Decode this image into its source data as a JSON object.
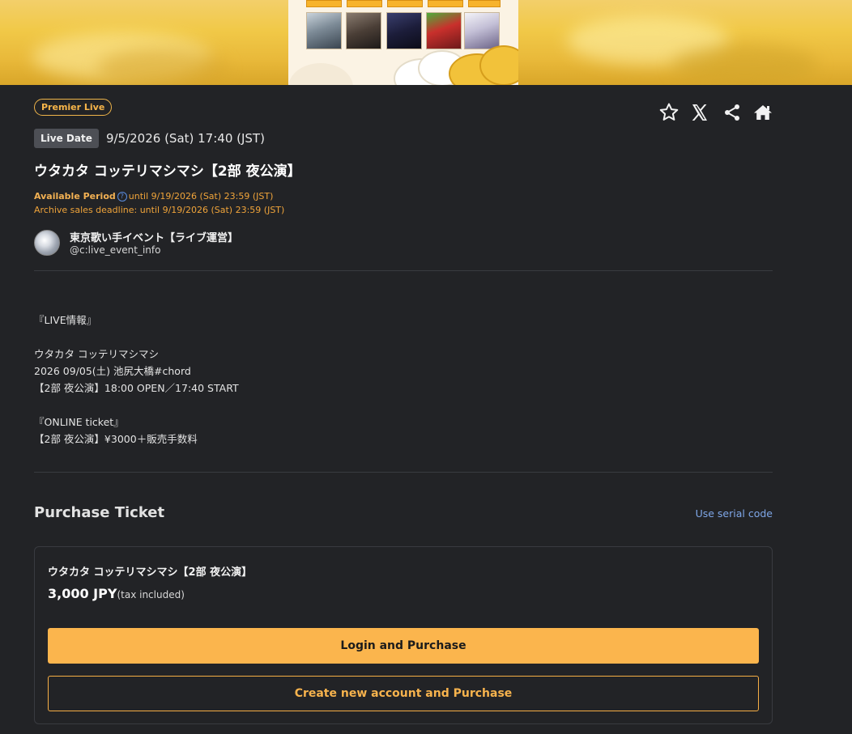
{
  "banner": {
    "accent": "#f1c948"
  },
  "event": {
    "badge": "Premier Live",
    "live_date_label": "Live Date",
    "live_date": "9/5/2026 (Sat) 17:40 (JST)",
    "title": "ウタカタ コッテリマシマシ【2部 夜公演】",
    "available_label": "Available Period",
    "available_value": "until 9/19/2026 (Sat) 23:59 (JST)",
    "archive_deadline": "Archive sales deadline: until 9/19/2026 (Sat) 23:59 (JST)"
  },
  "actions": {
    "icons": [
      "star-icon",
      "x-logo-icon",
      "share-icon",
      "home-icon"
    ]
  },
  "channel": {
    "name": "東京歌い手イベント【ライブ運営】",
    "handle": "@c:live_event_info"
  },
  "description": "『LIVE情報』\n\nウタカタ コッテリマシマシ\n2026 09/05(土) 池尻大橋#chord\n【2部 夜公演】18:00 OPEN／17:40 START\n\n『ONLINE ticket』\n【2部 夜公演】¥3000＋販売手数料",
  "purchase": {
    "title": "Purchase Ticket",
    "serial_link": "Use serial code",
    "ticket": {
      "name": "ウタカタ コッテリマシマシ【2部 夜公演】",
      "price": "3,000 JPY",
      "tax_note": "(tax included)"
    },
    "login_button": "Login and Purchase",
    "create_button": "Create new account and Purchase"
  },
  "colors": {
    "background": "#222326",
    "accent_orange": "#fbb54d",
    "link_blue": "#7fa7e8"
  }
}
